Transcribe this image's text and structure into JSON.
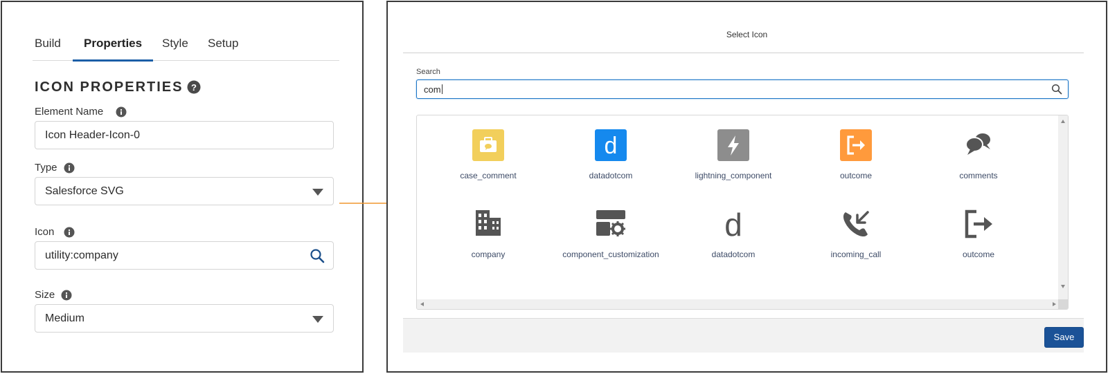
{
  "left_panel": {
    "tabs": [
      {
        "label": "Build",
        "active": false
      },
      {
        "label": "Properties",
        "active": true
      },
      {
        "label": "Style",
        "active": false
      },
      {
        "label": "Setup",
        "active": false
      }
    ],
    "section_title": "ICON PROPERTIES",
    "fields": {
      "element_name": {
        "label": "Element Name",
        "value": "Icon Header-Icon-0"
      },
      "type": {
        "label": "Type",
        "value": "Salesforce SVG"
      },
      "icon": {
        "label": "Icon",
        "value": "utility:company"
      },
      "size": {
        "label": "Size",
        "value": "Medium"
      }
    }
  },
  "modal": {
    "title": "Select Icon",
    "search": {
      "label": "Search",
      "value": "com"
    },
    "icons": [
      {
        "name": "case_comment",
        "icon": "case-comment-icon",
        "color": "#f2cf5b"
      },
      {
        "name": "datadotcom",
        "icon": "datadotcom-icon",
        "color": "#1589ee"
      },
      {
        "name": "lightning_component",
        "icon": "lightning-bolt-icon",
        "color": "#8d8d8d"
      },
      {
        "name": "outcome",
        "icon": "outcome-icon",
        "color": "#ff9a3c"
      },
      {
        "name": "comments",
        "icon": "comments-icon",
        "color": "#555555"
      },
      {
        "name": "company",
        "icon": "company-icon",
        "color": "#555555"
      },
      {
        "name": "component_customization",
        "icon": "component-customization-icon",
        "color": "#555555"
      },
      {
        "name": "datadotcom",
        "icon": "datadotcom-letter-icon",
        "color": "#555555"
      },
      {
        "name": "incoming_call",
        "icon": "incoming-call-icon",
        "color": "#555555"
      },
      {
        "name": "outcome",
        "icon": "outcome-utility-icon",
        "color": "#555555"
      }
    ],
    "save_label": "Save"
  },
  "colors": {
    "accent": "#1b5ea7",
    "arrow": "#f0962e",
    "save_button": "#1b5297"
  }
}
